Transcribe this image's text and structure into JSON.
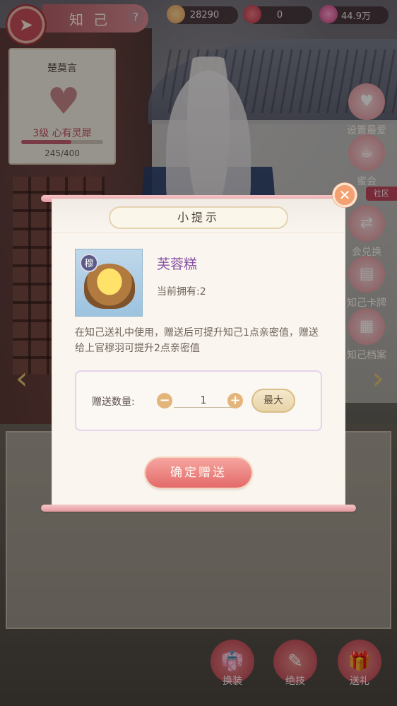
{
  "header": {
    "back_icon": "back-arrow-icon",
    "title": "知己",
    "help_label": "?",
    "resources": [
      {
        "name": "flower-currency-icon",
        "value": "28290"
      },
      {
        "name": "red-envelope-icon",
        "value": "0"
      },
      {
        "name": "pink-gem-icon",
        "value": "44.9万"
      }
    ]
  },
  "info_card": {
    "name": "楚莫言",
    "level_text": "3级 心有灵犀",
    "progress_text": "245/400",
    "progress_fraction": 0.6125
  },
  "side_menu": {
    "community": "社区",
    "items": [
      {
        "label": "设置最爱",
        "icon": "heart-icon"
      },
      {
        "label": "蜜会",
        "icon": "meeting-icon"
      },
      {
        "label": "会兑换",
        "icon": "exchange-icon"
      },
      {
        "label": "知己卡牌",
        "icon": "card-icon"
      },
      {
        "label": "知己档案",
        "icon": "file-icon"
      }
    ]
  },
  "bottom_menu": {
    "items": [
      {
        "label": "换装",
        "icon": "outfit-icon"
      },
      {
        "label": "绝技",
        "icon": "skill-icon"
      },
      {
        "label": "送礼",
        "icon": "gift-icon"
      }
    ]
  },
  "modal": {
    "title": "小提示",
    "close_label": "✕",
    "item": {
      "tag": "穆",
      "name": "芙蓉糕",
      "owned": "当前拥有:2",
      "description": "在知己送礼中使用，赠送后可提升知己1点亲密值，赠送给上官穆羽可提升2点亲密值"
    },
    "quantity": {
      "label": "赠送数量:",
      "minus": "−",
      "plus": "+",
      "value": "1",
      "max_label": "最大"
    },
    "confirm_label": "确定赠送"
  },
  "colors": {
    "accent": "#e36a6a",
    "item_name": "#8a55a6",
    "level_text": "#c44f5e"
  }
}
